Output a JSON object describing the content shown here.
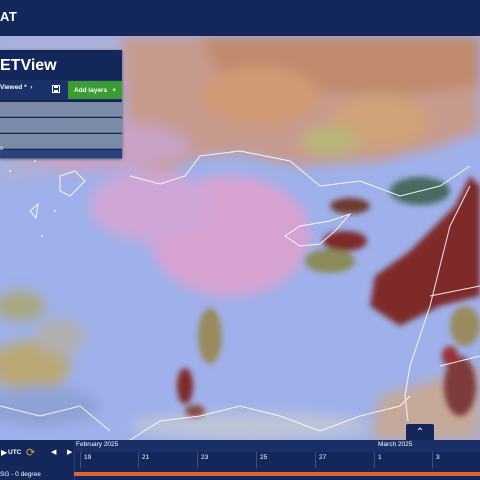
{
  "header": {
    "brand": "AT"
  },
  "panel": {
    "title": "ETView",
    "recent_label": "Viewed *",
    "add_layers_label": "Add layers",
    "footer_text": "s"
  },
  "timebar": {
    "tz_label": "UTC",
    "layer_label": "SG - 0 degree",
    "months": [
      "February 2025",
      "March 2025"
    ],
    "days": [
      "19",
      "21",
      "23",
      "25",
      "27",
      "1",
      "3"
    ]
  },
  "map": {
    "coastline_color": "#ffffff"
  }
}
